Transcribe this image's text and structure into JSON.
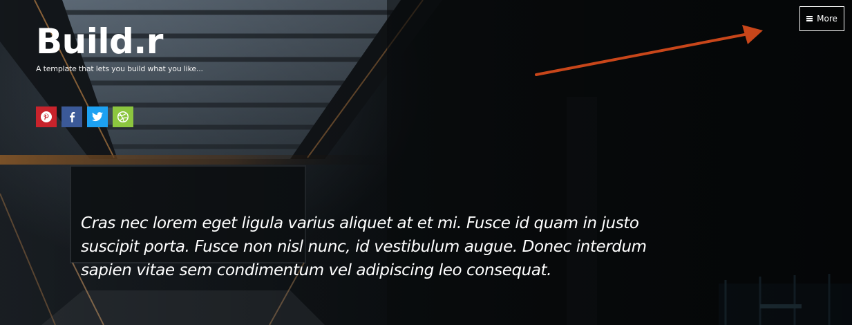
{
  "header": {
    "site_title": "Build.r",
    "tagline": "A template that lets you build what you like..."
  },
  "menu": {
    "more_label": "More",
    "icon": "hamburger-menu-icon"
  },
  "social": [
    {
      "network": "pinterest",
      "icon": "pinterest-icon",
      "color": "#c8232c"
    },
    {
      "network": "facebook",
      "icon": "facebook-icon",
      "color": "#3b5998"
    },
    {
      "network": "twitter",
      "icon": "twitter-icon",
      "color": "#1da1f2"
    },
    {
      "network": "dribbble",
      "icon": "dribbble-icon",
      "color": "#8cc63f"
    }
  ],
  "annotation": {
    "arrow_color": "#c8461a"
  },
  "hero": {
    "quote": "Cras nec lorem eget ligula varius aliquet at et mi. Fusce id quam in justo suscipit porta. Fusce non nisl nunc, id vestibulum augue. Donec interdum sapien vitae sem condimentum vel adipiscing leo consequat."
  }
}
